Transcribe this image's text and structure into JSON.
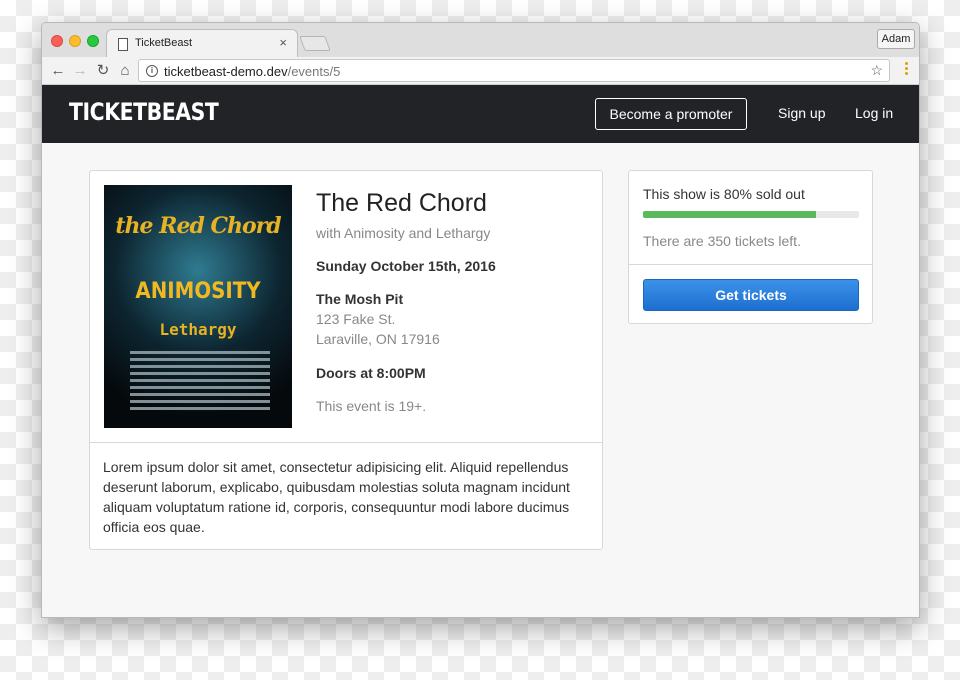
{
  "browser": {
    "tab_title": "TicketBeast",
    "tab_close": "×",
    "profile_name": "Adam",
    "url_host": "ticketbeast-demo.dev",
    "url_path": "/events/5",
    "back_glyph": "←",
    "forward_glyph": "→",
    "reload_glyph": "↻",
    "home_glyph": "⌂",
    "info_glyph": "i",
    "star_glyph": "☆"
  },
  "navbar": {
    "brand": "TICKETBEAST",
    "promoter_label": "Become a promoter",
    "signup_label": "Sign up",
    "login_label": "Log in"
  },
  "event": {
    "title": "The Red Chord",
    "subtitle": "with Animosity and Lethargy",
    "date": "Sunday October 15th, 2016",
    "venue": "The Mosh Pit",
    "street": "123 Fake St.",
    "city": "Laraville, ON 17916",
    "doors": "Doors at 8:00PM",
    "age_note": "This event is 19+.",
    "description": "Lorem ipsum dolor sit amet, consectetur adipisicing elit. Aliquid repellendus deserunt laborum, explicabo, quibusdam molestias soluta magnam incidunt aliquam voluptatum ratione id, corporis, consequuntur modi labore ducimus officia eos quae.",
    "poster": {
      "headliner": "the Red Chord",
      "support_1": "ANIMOSITY",
      "support_2": "Lethargy"
    }
  },
  "tickets": {
    "sold_text": "This show is 80% sold out",
    "sold_fraction": 0.8,
    "remaining_text": "There are 350 tickets left.",
    "button_label": "Get tickets"
  },
  "colors": {
    "navbar_bg": "#222326",
    "progress_fill": "#5cb85c",
    "button_blue": "#2a7fdc"
  },
  "icons": {
    "tab_icon": "document-icon",
    "info": "info-icon",
    "bookmark": "star-icon",
    "menu": "kebab-menu-icon"
  }
}
